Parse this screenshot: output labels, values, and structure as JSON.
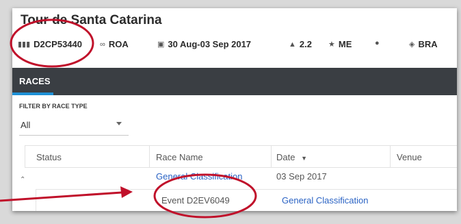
{
  "header": {
    "title": "Tour de Santa Catarina",
    "meta": {
      "code": "D2CP53440",
      "discipline": "ROA",
      "dates": "30 Aug-03 Sep 2017",
      "class": "2.2",
      "category": "ME",
      "location": "",
      "country": "BRA"
    }
  },
  "nav": {
    "tab_races": "RACES"
  },
  "filter": {
    "label": "FILTER BY RACE TYPE",
    "selected": "All"
  },
  "table": {
    "columns": [
      "Status",
      "Race Name",
      "Date",
      "Venue"
    ],
    "row": {
      "race_name": "General Classification",
      "date": "03 Sep 2017"
    },
    "subrow": {
      "event": "Event D2EV6049",
      "name": "General Classification"
    }
  },
  "icons": {
    "code": "barcode-icon",
    "discipline": "bicycle-icon",
    "dates": "calendar-icon",
    "class": "class-icon",
    "category": "star-icon",
    "location": "map-pin-icon",
    "country": "globe-icon",
    "sort": "sort-down-icon",
    "expand": "chevron-up-icon",
    "select": "dropdown-arrow-icon"
  },
  "colors": {
    "nav_bg": "#3a3e43",
    "tab_underline": "#1e90d6",
    "link": "#2a63c4",
    "annotation": "#c0102a"
  }
}
